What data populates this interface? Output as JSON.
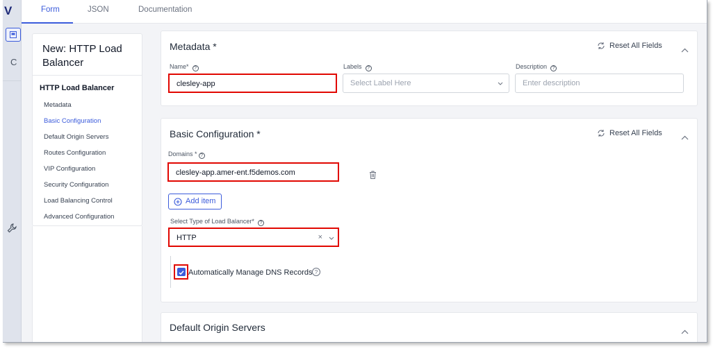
{
  "rail": {
    "logo": "V",
    "letter": "C"
  },
  "tabs": [
    {
      "label": "Form",
      "active": true
    },
    {
      "label": "JSON"
    },
    {
      "label": "Documentation"
    }
  ],
  "nav": {
    "title": "New: HTTP Load Balancer",
    "section": "HTTP Load Balancer",
    "items": [
      {
        "label": "Metadata"
      },
      {
        "label": "Basic Configuration",
        "active": true
      },
      {
        "label": "Default Origin Servers"
      },
      {
        "label": "Routes Configuration"
      },
      {
        "label": "VIP Configuration"
      },
      {
        "label": "Security Configuration"
      },
      {
        "label": "Load Balancing Control"
      },
      {
        "label": "Advanced Configuration"
      }
    ]
  },
  "metadata": {
    "title": "Metadata *",
    "reset_label": "Reset All Fields",
    "name_label": "Name*",
    "name_value": "clesley-app",
    "labels_label": "Labels",
    "labels_placeholder": "Select Label Here",
    "description_label": "Description",
    "description_placeholder": "Enter description"
  },
  "basic": {
    "title": "Basic Configuration *",
    "reset_label": "Reset All Fields",
    "domains_label": "Domains *",
    "domain_value": "clesley-app.amer-ent.f5demos.com",
    "add_item_label": "Add item",
    "lb_type_label": "Select Type of Load Balancer*",
    "lb_type_value": "HTTP",
    "dns_label": "Automatically Manage DNS Records",
    "dns_checked": true
  },
  "origin": {
    "title": "Default Origin Servers"
  },
  "colors": {
    "accent": "#3b5bdb",
    "highlight": "#e10600"
  }
}
